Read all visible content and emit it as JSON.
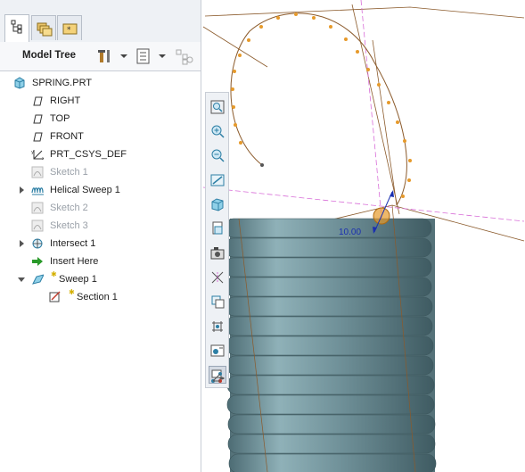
{
  "panel": {
    "tabs": [
      {
        "name": "model-tree-tab",
        "icon": "tree-icon",
        "active": true
      },
      {
        "name": "folder-browser-tab",
        "icon": "folders-icon",
        "active": false
      },
      {
        "name": "favorites-tab",
        "icon": "favorites-folder-icon",
        "active": false
      }
    ],
    "title": "Model Tree",
    "toolbar_icons": [
      "settings-tools-icon",
      "show-options-icon",
      "filter-icon"
    ]
  },
  "tree": {
    "items": [
      {
        "label": "SPRING.PRT",
        "icon": "part-icon",
        "state": "normal"
      },
      {
        "label": "RIGHT",
        "icon": "datum-plane-icon",
        "state": "normal"
      },
      {
        "label": "TOP",
        "icon": "datum-plane-icon",
        "state": "normal"
      },
      {
        "label": "FRONT",
        "icon": "datum-plane-icon",
        "state": "normal"
      },
      {
        "label": "PRT_CSYS_DEF",
        "icon": "csys-icon",
        "state": "normal"
      },
      {
        "label": "Sketch 1",
        "icon": "sketch-icon",
        "state": "dim"
      },
      {
        "label": "Helical Sweep 1",
        "icon": "helical-sweep-icon",
        "state": "collapsed"
      },
      {
        "label": "Sketch 2",
        "icon": "sketch-icon",
        "state": "dim"
      },
      {
        "label": "Sketch 3",
        "icon": "sketch-icon",
        "state": "dim"
      },
      {
        "label": "Intersect 1",
        "icon": "intersect-icon",
        "state": "collapsed"
      },
      {
        "label": "Insert Here",
        "icon": "insert-arrow-icon",
        "state": "normal"
      },
      {
        "label": "Sweep 1",
        "icon": "sweep-icon",
        "state": "expanded"
      },
      {
        "label": "Section 1",
        "icon": "section-icon",
        "state": "normal"
      }
    ]
  },
  "graphics": {
    "dimension_value": "10.00",
    "toolbar": [
      "zoom-fit-icon",
      "zoom-in-icon",
      "zoom-out-icon",
      "repaint-icon",
      "display-style-icon",
      "saved-views-icon",
      "view-manager-icon",
      "datum-display-icon",
      "annotation-display-icon",
      "spin-center-icon",
      "dimension-display-icon",
      "preview-toggle-icon",
      "connection-icon"
    ],
    "colors": {
      "spring": "#6f9098",
      "trajectory": "#8b5a2b",
      "points": "#e69a2b",
      "datum": "#d86ed8",
      "dimension": "#1a2fb0"
    }
  }
}
